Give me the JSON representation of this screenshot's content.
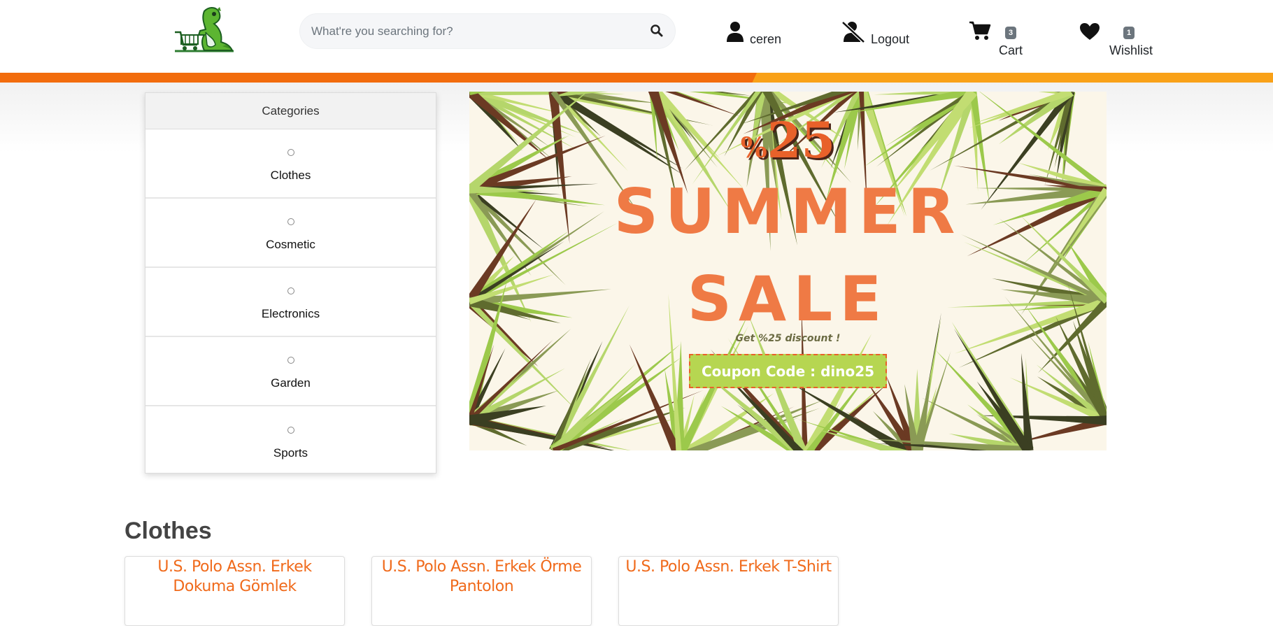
{
  "header": {
    "logo_icon": "dino-shopping-cart-logo",
    "search": {
      "placeholder": "What're you searching for?",
      "value": "",
      "icon": "search-icon"
    },
    "user": {
      "label": "ceren",
      "icon": "user-icon"
    },
    "logout": {
      "label": "Logout",
      "icon": "user-slash-icon"
    },
    "cart": {
      "label": "Cart",
      "count": "3",
      "icon": "cart-icon"
    },
    "wishlist": {
      "label": "Wishlist",
      "count": "1",
      "icon": "heart-icon"
    }
  },
  "colors": {
    "accent": "#f26c0d",
    "accent_light": "#f9a118",
    "product_title": "#f06a1b",
    "badge": "#6c757d"
  },
  "categories": {
    "title": "Categories",
    "items": [
      {
        "label": "Clothes",
        "icon": "circle-icon"
      },
      {
        "label": "Cosmetic",
        "icon": "circle-icon"
      },
      {
        "label": "Electronics",
        "icon": "circle-icon"
      },
      {
        "label": "Garden",
        "icon": "circle-icon"
      },
      {
        "label": "Sports",
        "icon": "circle-icon"
      }
    ]
  },
  "banner": {
    "percent_sign": "%",
    "percent_value": "25",
    "line1": "SUMMER",
    "line2": "SALE",
    "subtitle": "Get %25 discount !",
    "coupon": "Coupon Code : dino25"
  },
  "section": {
    "title": "Clothes",
    "products": [
      {
        "title": "U.S. Polo Assn. Erkek Dokuma Gömlek"
      },
      {
        "title": "U.S. Polo Assn. Erkek Örme Pantolon"
      },
      {
        "title": "U.S. Polo Assn. Erkek T-Shirt"
      }
    ]
  }
}
